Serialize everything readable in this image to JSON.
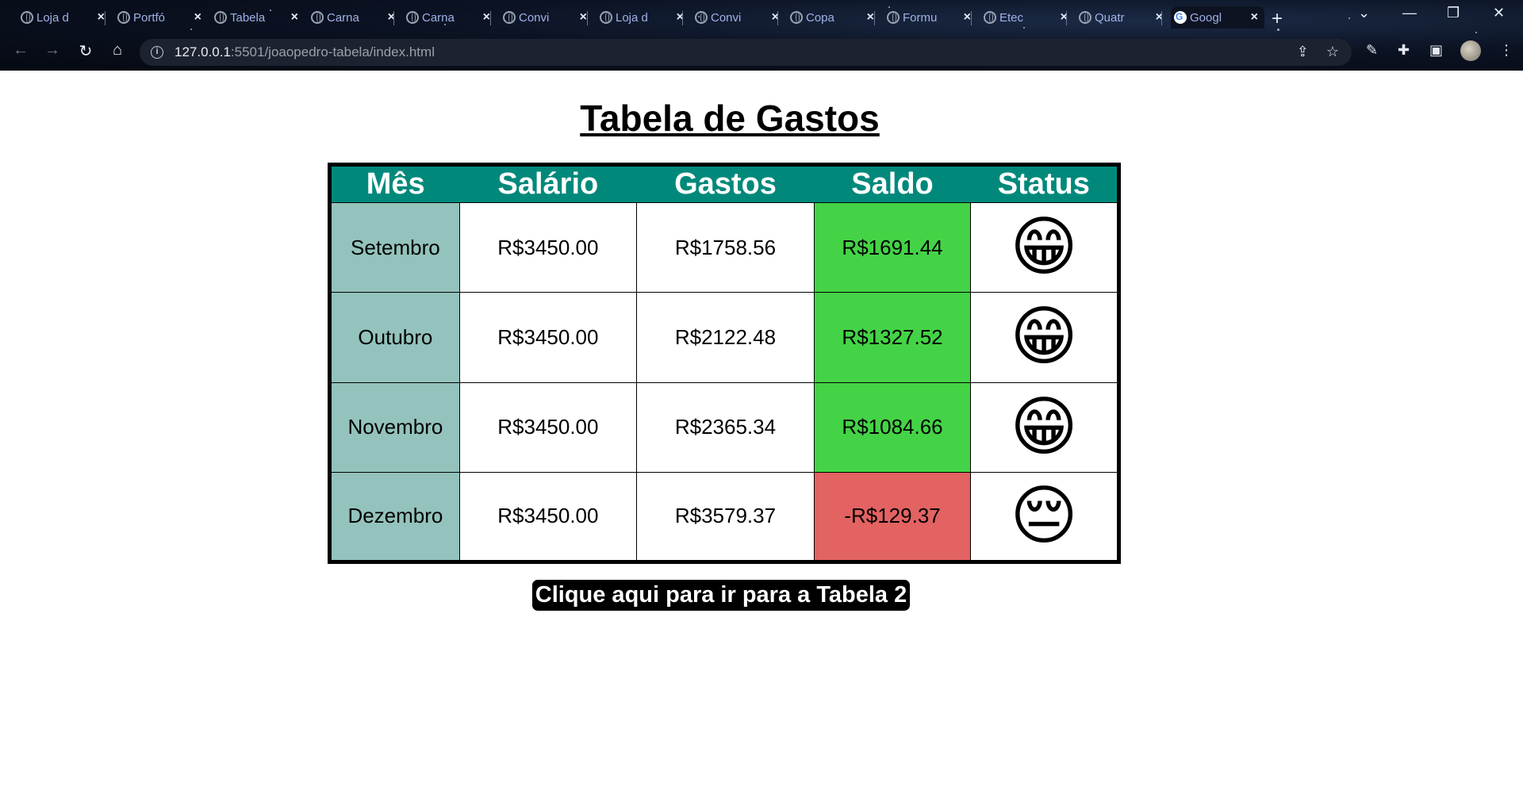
{
  "browser": {
    "tabs": [
      {
        "title": "Loja d",
        "favicon": "globe-icon"
      },
      {
        "title": "Portfó",
        "favicon": "globe-icon"
      },
      {
        "title": "Tabela",
        "favicon": "globe-icon"
      },
      {
        "title": "Carna",
        "favicon": "globe-icon"
      },
      {
        "title": "Carna",
        "favicon": "globe-icon"
      },
      {
        "title": "Convi",
        "favicon": "globe-icon"
      },
      {
        "title": "Loja d",
        "favicon": "globe-icon"
      },
      {
        "title": "Convi",
        "favicon": "globe-icon"
      },
      {
        "title": "Copa",
        "favicon": "globe-icon"
      },
      {
        "title": "Formu",
        "favicon": "globe-icon"
      },
      {
        "title": "Etec",
        "favicon": "globe-icon"
      },
      {
        "title": "Quatr",
        "favicon": "globe-icon"
      },
      {
        "title": "Googl",
        "favicon": "google-icon",
        "active": true
      }
    ],
    "url_host": "127.0.0.1",
    "url_rest": ":5501/joaopedro-tabela/index.html"
  },
  "page": {
    "title": "Tabela de Gastos",
    "table": {
      "headers": [
        "Mês",
        "Salário",
        "Gastos",
        "Saldo",
        "Status"
      ],
      "rows": [
        {
          "mes": "Setembro",
          "salario": "R$3450.00",
          "gastos": "R$1758.56",
          "saldo": "R$1691.44",
          "status": "😁",
          "status_icon": "grinning-face-emoji",
          "saldo_state": "positive"
        },
        {
          "mes": "Outubro",
          "salario": "R$3450.00",
          "gastos": "R$2122.48",
          "saldo": "R$1327.52",
          "status": "😁",
          "status_icon": "grinning-face-emoji",
          "saldo_state": "positive"
        },
        {
          "mes": "Novembro",
          "salario": "R$3450.00",
          "gastos": "R$2365.34",
          "saldo": "R$1084.66",
          "status": "😁",
          "status_icon": "grinning-face-emoji",
          "saldo_state": "positive"
        },
        {
          "mes": "Dezembro",
          "salario": "R$3450.00",
          "gastos": "R$3579.37",
          "saldo": "-R$129.37",
          "status": "😔",
          "status_icon": "pensive-face-emoji",
          "saldo_state": "negative"
        }
      ]
    },
    "link_label": "Clique aqui para ir para a Tabela 2"
  },
  "colors": {
    "header_bg": "#00897b",
    "month_bg": "#93c3bc",
    "positive_bg": "#44d346",
    "negative_bg": "#e36262"
  }
}
